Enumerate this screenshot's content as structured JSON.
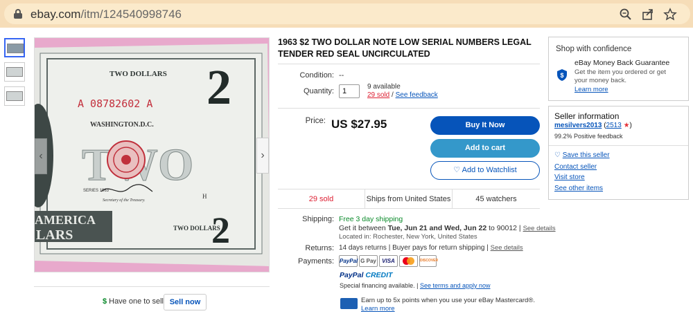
{
  "browser": {
    "url_domain": "ebay.com",
    "url_path": "/itm/124540998746"
  },
  "product": {
    "title": "1963 $2 TWO DOLLAR NOTE LOW SERIAL NUMBERS LEGAL TENDER RED SEAL UNCIRCULATED",
    "condition_label": "Condition:",
    "condition_value": "--",
    "quantity_label": "Quantity:",
    "quantity_value": "1",
    "available": "9 available",
    "sold_link": "29 sold",
    "sep": "/",
    "feedback_link": "See feedback",
    "price_label": "Price:",
    "price": "US $27.95"
  },
  "note_image": {
    "serial": "A 08782602 A",
    "header": "TWO DOLLARS",
    "place": "WASHINGTON.D.C.",
    "series": "SERIES 1963",
    "footer": "TWO DOLLARS",
    "word": "TWO",
    "numeral": "2",
    "america": "AMERICA",
    "lars": "LARS",
    "secretary": "Secretary of the Treasury.",
    "plate_letter": "H"
  },
  "buttons": {
    "buy": "Buy It Now",
    "cart": "Add to cart",
    "watch": "Add to Watchlist",
    "sell_now": "Sell now"
  },
  "stats": {
    "sold": "29 sold",
    "ships": "Ships from United States",
    "watchers": "45 watchers"
  },
  "shipping": {
    "label": "Shipping:",
    "free": "Free 3 day shipping",
    "between_prefix": "Get it between",
    "date_range": "Tue, Jun 21 and Wed, Jun 22",
    "to_zip": "to 90012",
    "details_link": "See details",
    "location": "Located in: Rochester, New York, United States"
  },
  "returns": {
    "label": "Returns:",
    "text": "14 days returns | Buyer pays for return shipping |",
    "details_link": "See details"
  },
  "payments": {
    "label": "Payments:",
    "methods": [
      "PayPal",
      "G Pay",
      "VISA",
      "MC",
      "DISCOVER"
    ],
    "paypal_credit_brand": "PayPal",
    "paypal_credit_word": "CREDIT",
    "financing": "Special financing available. |",
    "financing_link": "See terms and apply now",
    "earn": "Earn up to 5x points when you use your eBay Mastercard®.",
    "learn_more": "Learn more"
  },
  "sell": {
    "prompt": "Have one to sell?"
  },
  "confidence": {
    "title": "Shop with confidence",
    "guarantee_title": "eBay Money Back Guarantee",
    "guarantee_text": "Get the item you ordered or get your money back.",
    "learn_more": "Learn more"
  },
  "seller": {
    "title": "Seller information",
    "name": "mesilvers2013",
    "rating_open": "(",
    "rating": "2513",
    "rating_close": ")",
    "positive": "99.2% Positive feedback",
    "save": "Save this seller",
    "contact": "Contact seller",
    "visit": "Visit store",
    "other": "See other items"
  },
  "colors": {
    "primary_blue": "#0654ba",
    "cart_blue": "#3498ca",
    "sold_red": "#dd1e31",
    "shipping_green": "#0a8a2a",
    "address_bar": "#f6ddb8",
    "image_bg": "#e8a9cc"
  }
}
